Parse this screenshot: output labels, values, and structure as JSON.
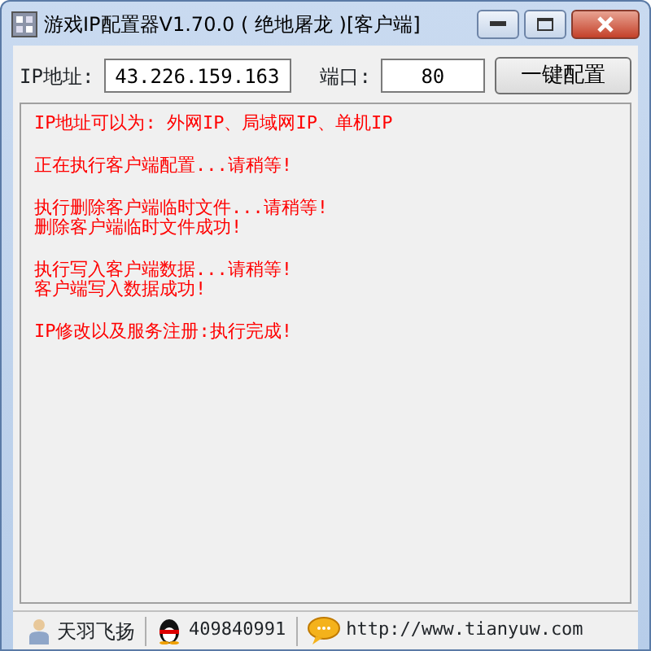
{
  "window": {
    "title": "游戏IP配置器V1.70.0 ( 绝地屠龙 )[客户端]"
  },
  "ip": {
    "label": "IP地址:",
    "value": "43.226.159.163"
  },
  "port": {
    "label": "端口:",
    "value": "80"
  },
  "configure_button": "一键配置",
  "log": [
    {
      "lines": [
        "IP地址可以为:  外网IP、局域网IP、单机IP"
      ]
    },
    {
      "lines": [
        "正在执行客户端配置...请稍等!"
      ]
    },
    {
      "lines": [
        "执行删除客户端临时文件...请稍等!",
        "删除客户端临时文件成功!"
      ]
    },
    {
      "lines": [
        "执行写入客户端数据...请稍等!",
        "客户端写入数据成功!"
      ]
    },
    {
      "lines": [
        "IP修改以及服务注册:执行完成!"
      ]
    }
  ],
  "status_bar": [
    {
      "kind": "user",
      "text": "天羽飞扬"
    },
    {
      "kind": "qq",
      "text": "409840991"
    },
    {
      "kind": "chat",
      "text": "http://www.tianyuw.com"
    }
  ]
}
